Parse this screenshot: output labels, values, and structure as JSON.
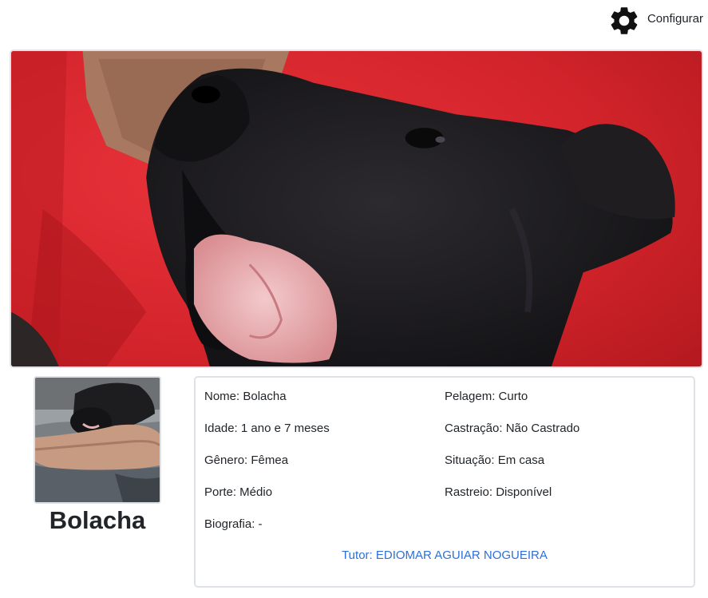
{
  "header": {
    "settings_icon": "gear-icon",
    "settings_label": "Configurar"
  },
  "pet": {
    "name": "Bolacha",
    "cover_image": "photo of a black puppy with mouth open, held against a red shirt",
    "avatar_image": "photo of a black puppy resting on a person's arm"
  },
  "details": {
    "nome": "Nome: Bolacha",
    "idade": "Idade: 1 ano e 7 meses",
    "genero": "Gênero: Fêmea",
    "porte": "Porte: Médio",
    "biografia": "Biografia: -",
    "pelagem": "Pelagem: Curto",
    "castracao": "Castração: Não Castrado",
    "situacao": "Situação: Em casa",
    "rastreio": "Rastreio: Disponível",
    "tutor": "Tutor: EDIOMAR AGUIAR NOGUEIRA"
  },
  "colors": {
    "border": "#dee2e6",
    "link": "#2f6fd6",
    "text": "#212529",
    "shirt_red": "#d8262a"
  }
}
